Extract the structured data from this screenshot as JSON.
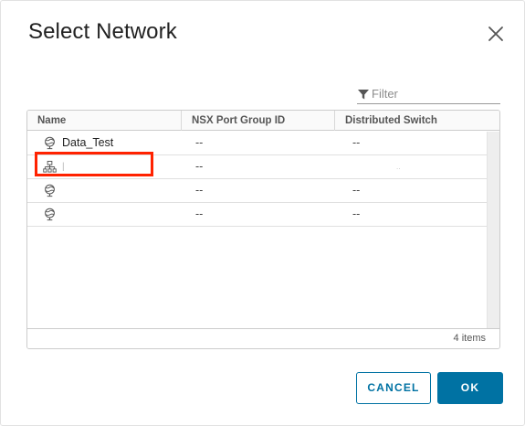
{
  "dialog": {
    "title": "Select Network",
    "close_icon": "close-icon"
  },
  "filter": {
    "icon": "filter-icon",
    "placeholder": "Filter",
    "value": ""
  },
  "grid": {
    "columns": [
      "Name",
      "NSX Port Group ID",
      "Distributed Switch"
    ],
    "rows": [
      {
        "icon": "network-globe-icon",
        "name": "Data_Test",
        "nsx_port_group_id": "--",
        "distributed_switch": "--",
        "highlighted": true
      },
      {
        "icon": "network-switch-icon",
        "name": "|",
        "nsx_port_group_id": "--",
        "distributed_switch": "..",
        "highlighted": false
      },
      {
        "icon": "network-globe-icon",
        "name": "",
        "nsx_port_group_id": "--",
        "distributed_switch": "--",
        "highlighted": false
      },
      {
        "icon": "network-globe-icon",
        "name": "",
        "nsx_port_group_id": "--",
        "distributed_switch": "--",
        "highlighted": false
      }
    ],
    "footer": "4 items"
  },
  "buttons": {
    "cancel": "CANCEL",
    "ok": "OK"
  },
  "colors": {
    "accent": "#0072a3",
    "highlight": "#ff2200",
    "border": "#cccccc"
  }
}
